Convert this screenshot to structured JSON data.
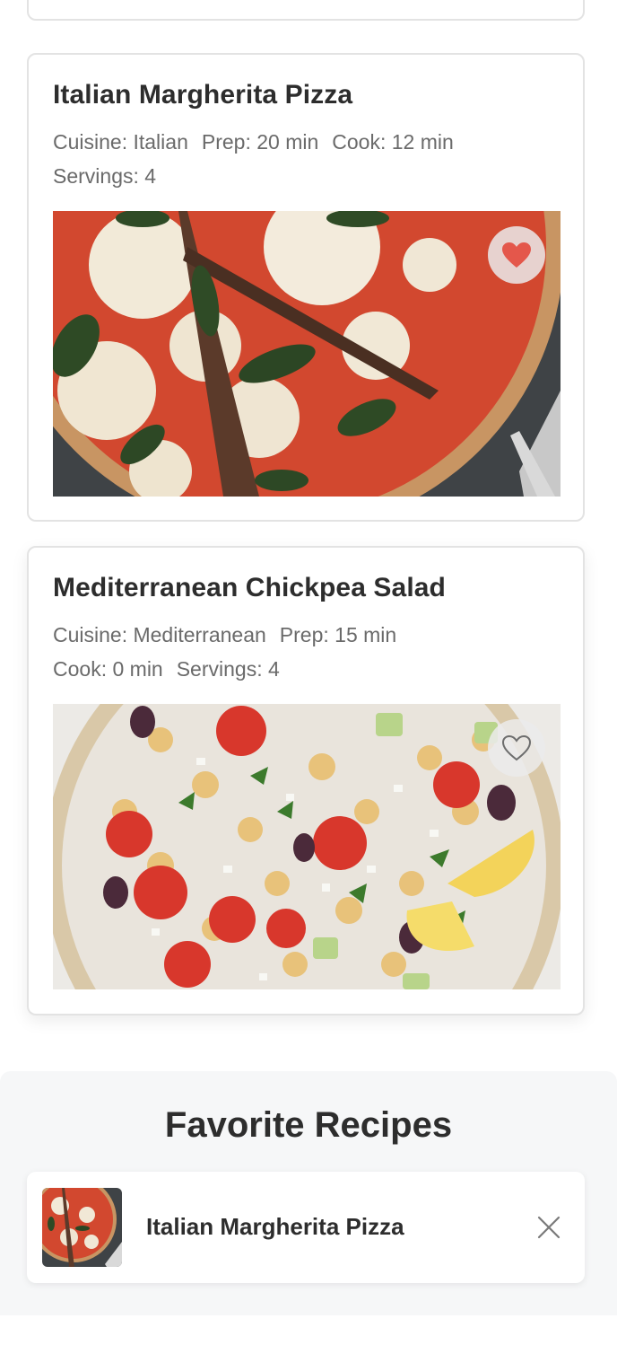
{
  "recipes": [
    {
      "title": "Italian Margherita Pizza",
      "cuisine": "Cuisine: Italian",
      "prep": "Prep: 20 min",
      "cook": "Cook: 12 min",
      "servings": "Servings: 4",
      "favorite": true,
      "favorite_icon": "heart-filled-icon"
    },
    {
      "title": "Mediterranean Chickpea Salad",
      "cuisine": "Cuisine: Mediterranean",
      "prep": "Prep: 15 min",
      "cook": "Cook: 0 min",
      "servings": "Servings: 4",
      "favorite": false,
      "favorite_icon": "heart-outline-icon"
    }
  ],
  "favorites": {
    "heading": "Favorite Recipes",
    "items": [
      {
        "name": "Italian Margherita Pizza",
        "remove_icon": "close-icon"
      }
    ]
  },
  "colors": {
    "heart_active": "#e4574b",
    "heart_inactive": "#6d6d6d",
    "card_border": "#e3e3e3",
    "favorites_bg": "#f6f7f8"
  }
}
